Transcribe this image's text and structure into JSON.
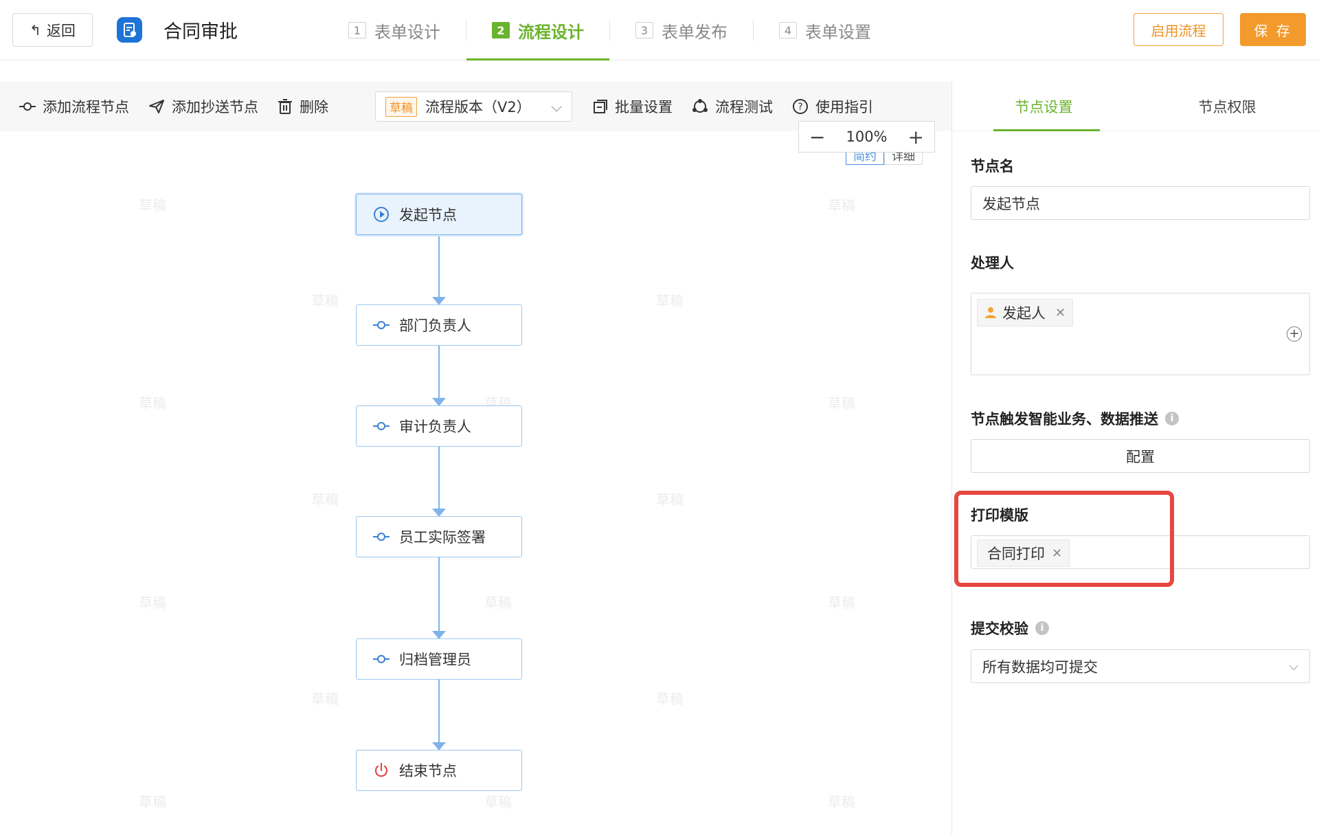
{
  "topbar": {
    "back_label": "返回",
    "app_title": "合同审批",
    "steps": [
      {
        "num": "1",
        "label": "表单设计"
      },
      {
        "num": "2",
        "label": "流程设计"
      },
      {
        "num": "3",
        "label": "表单发布"
      },
      {
        "num": "4",
        "label": "表单设置"
      }
    ],
    "enable_label": "启用流程",
    "save_label": "保 存"
  },
  "toolbar": {
    "add_node": "添加流程节点",
    "add_cc": "添加抄送节点",
    "delete": "删除",
    "draft_tag": "草稿",
    "version": "流程版本（V2）",
    "batch": "批量设置",
    "test": "流程测试",
    "guide": "使用指引"
  },
  "canvas": {
    "zoom": "100%",
    "zoom_out": "−",
    "zoom_in": "+",
    "mode_simple": "简约",
    "mode_detail": "详细",
    "watermark": "草稿",
    "nodes": [
      {
        "label": "发起节点",
        "type": "start"
      },
      {
        "label": "部门负责人",
        "type": "approve"
      },
      {
        "label": "审计负责人",
        "type": "approve"
      },
      {
        "label": "员工实际签署",
        "type": "approve"
      },
      {
        "label": "归档管理员",
        "type": "approve"
      },
      {
        "label": "结束节点",
        "type": "end"
      }
    ]
  },
  "panel": {
    "tab_settings": "节点设置",
    "tab_permission": "节点权限",
    "node_name_label": "节点名",
    "node_name_value": "发起节点",
    "handler_label": "处理人",
    "handler_chip": "发起人",
    "trigger_label": "节点触发智能业务、数据推送",
    "config_label": "配置",
    "print_label": "打印模版",
    "print_chip": "合同打印",
    "submit_label": "提交校验",
    "submit_value": "所有数据均可提交"
  },
  "colors": {
    "accent_green": "#6ab32d",
    "accent_orange": "#f39a2c",
    "node_blue": "#7fb3ea",
    "highlight_red": "#e5483f"
  }
}
